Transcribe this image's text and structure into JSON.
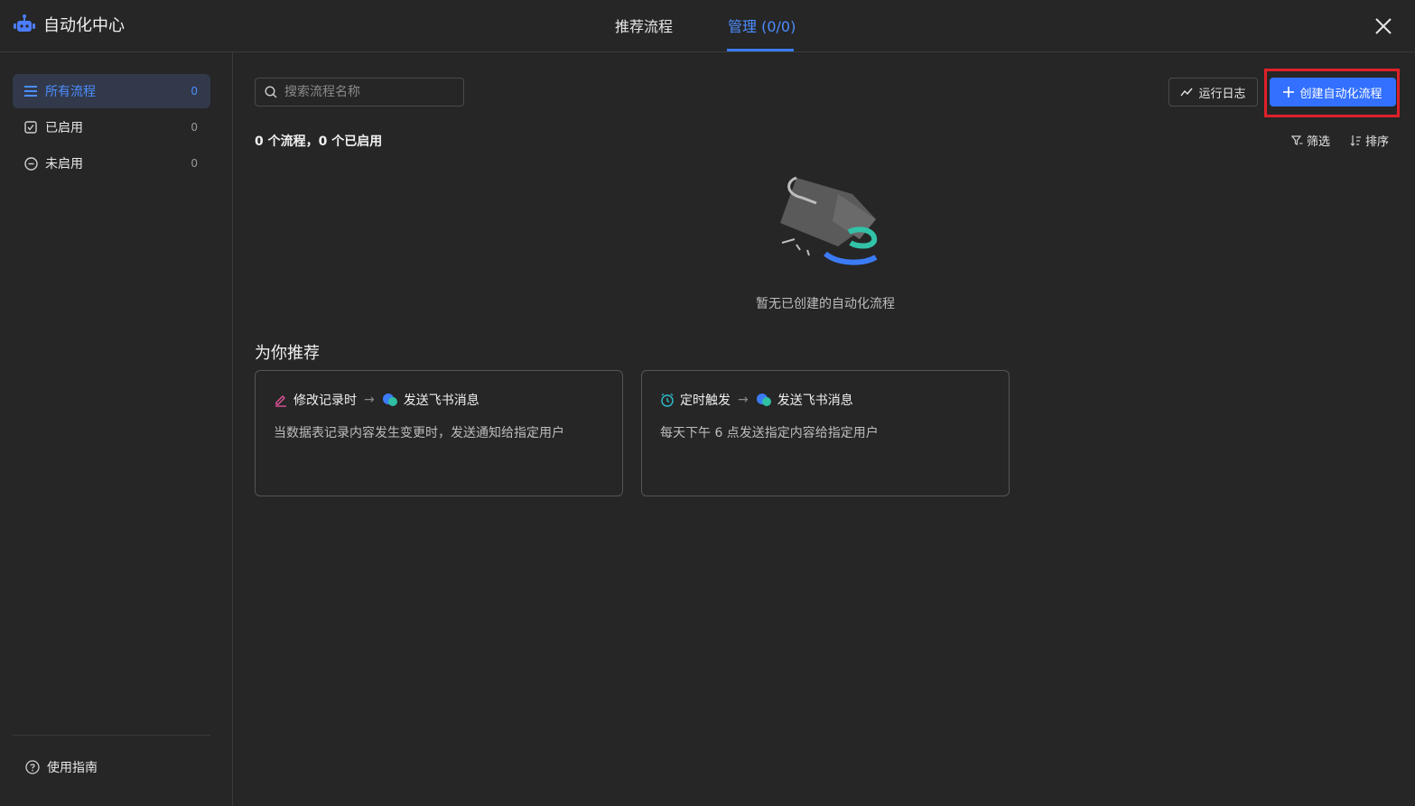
{
  "app": {
    "title": "自动化中心"
  },
  "tabs": [
    {
      "label": "推荐流程",
      "active": false
    },
    {
      "label": "管理 (0/0)",
      "active": true
    }
  ],
  "sidebar": {
    "items": [
      {
        "label": "所有流程",
        "count": "0",
        "icon": "list-icon",
        "active": true
      },
      {
        "label": "已启用",
        "count": "0",
        "icon": "checkbox-icon",
        "active": false
      },
      {
        "label": "未启用",
        "count": "0",
        "icon": "minus-circle-icon",
        "active": false
      }
    ],
    "guide_label": "使用指南"
  },
  "toolbar": {
    "search_placeholder": "搜索流程名称",
    "log_label": "运行日志",
    "create_label": "创建自动化流程"
  },
  "summary": "0 个流程，0 个已启用",
  "filter_label": "筛选",
  "sort_label": "排序",
  "empty_text": "暂无已创建的自动化流程",
  "recommend": {
    "title": "为你推荐",
    "cards": [
      {
        "trigger": "修改记录时",
        "trigger_icon": "edit-icon",
        "action": "发送飞书消息",
        "action_icon": "feishu-icon",
        "desc": "当数据表记录内容发生变更时，发送通知给指定用户"
      },
      {
        "trigger": "定时触发",
        "trigger_icon": "alarm-clock-icon",
        "action": "发送飞书消息",
        "action_icon": "feishu-icon",
        "desc": "每天下午 6 点发送指定内容给指定用户"
      }
    ],
    "arrow": "→"
  },
  "colors": {
    "accent": "#3370ff",
    "highlight": "#e0202a",
    "background": "#262626"
  }
}
